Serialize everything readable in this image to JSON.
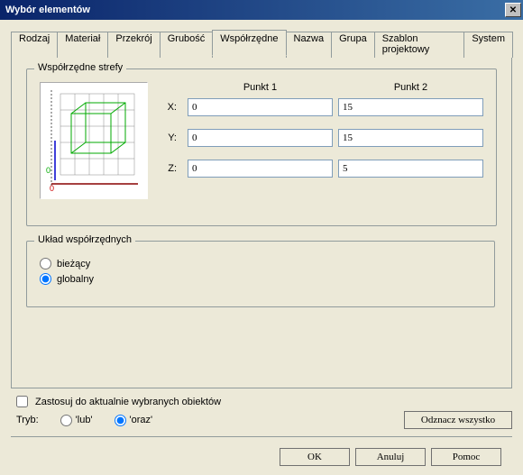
{
  "window": {
    "title": "Wybór elementów"
  },
  "tabs": {
    "items": [
      {
        "label": "Rodzaj"
      },
      {
        "label": "Materiał"
      },
      {
        "label": "Przekrój"
      },
      {
        "label": "Grubość"
      },
      {
        "label": "Współrzędne"
      },
      {
        "label": "Nazwa"
      },
      {
        "label": "Grupa"
      },
      {
        "label": "Szablon projektowy"
      },
      {
        "label": "System"
      }
    ],
    "active_index": 4
  },
  "zone": {
    "group_title": "Współrzędne strefy",
    "headers": {
      "p1": "Punkt 1",
      "p2": "Punkt 2"
    },
    "rows": {
      "x": {
        "label": "X:",
        "p1": "0",
        "p2": "15"
      },
      "y": {
        "label": "Y:",
        "p1": "0",
        "p2": "15"
      },
      "z": {
        "label": "Z:",
        "p1": "0",
        "p2": "5"
      }
    }
  },
  "csys": {
    "group_title": "Układ współrzędnych",
    "current": "bieżący",
    "global": "globalny",
    "selected": "global"
  },
  "apply": {
    "label": "Zastosuj do aktualnie wybranych obiektów",
    "checked": false
  },
  "mode": {
    "label": "Tryb:",
    "or": "'lub'",
    "and": "'oraz'",
    "selected": "and"
  },
  "buttons": {
    "deselect": "Odznacz wszystko",
    "ok": "OK",
    "cancel": "Anuluj",
    "help": "Pomoc"
  }
}
